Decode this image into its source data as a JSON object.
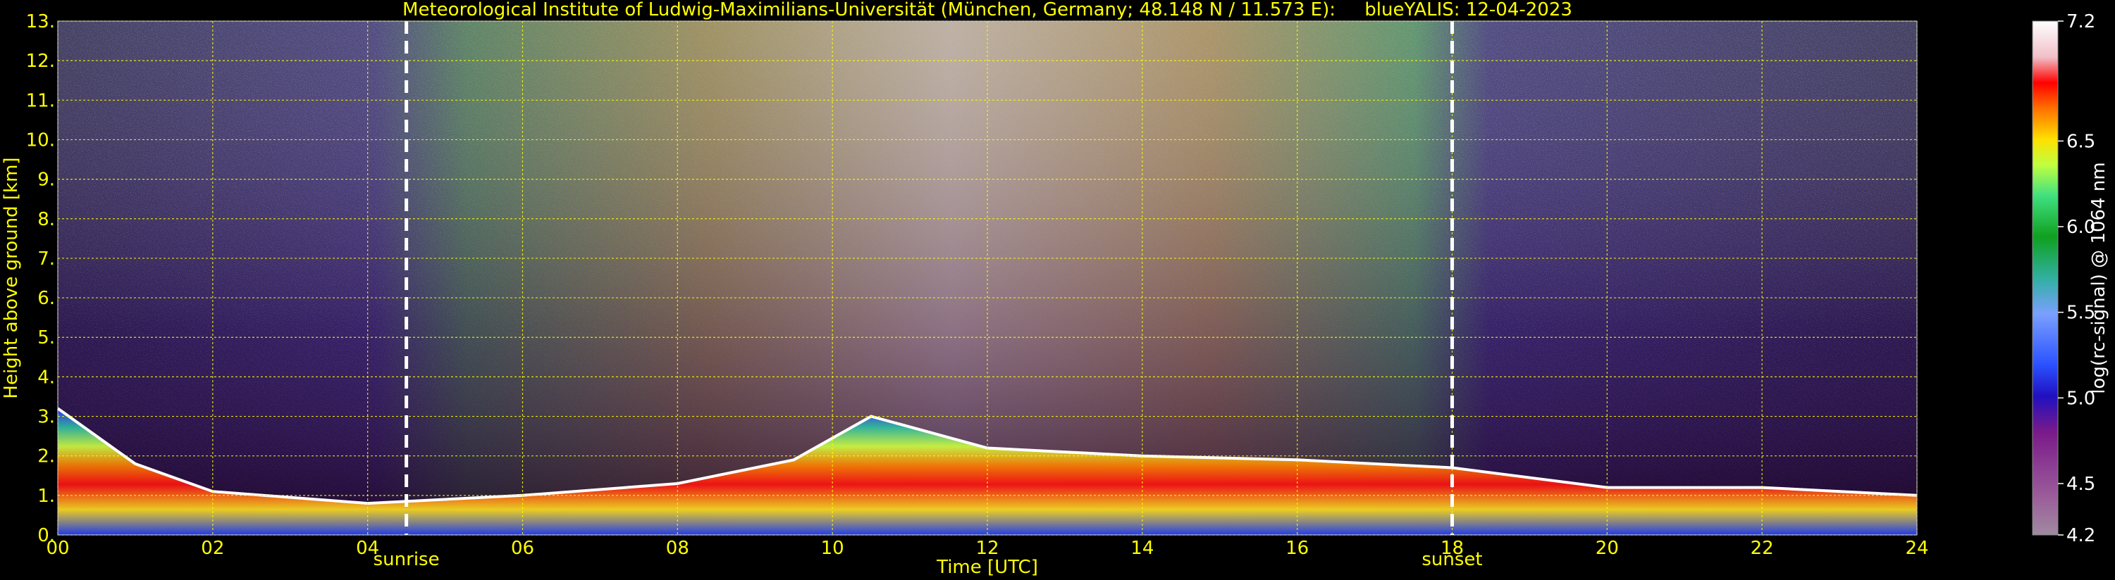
{
  "chart_data": {
    "type": "heatmap",
    "title": "Meteorological Institute of Ludwig-Maximilians-Universität (München, Germany; 48.148 N / 11.573 E):     blueYALIS: 12-04-2023",
    "xlabel": "Time [UTC]",
    "ylabel": "Height above ground [km]",
    "xlim": [
      0,
      24
    ],
    "ylim": [
      0,
      13
    ],
    "x_ticks": [
      "00",
      "02",
      "04",
      "06",
      "08",
      "10",
      "12",
      "14",
      "16",
      "18",
      "20",
      "22",
      "24"
    ],
    "y_ticks": [
      "0.",
      "1.",
      "2.",
      "3.",
      "4.",
      "5.",
      "6.",
      "7.",
      "8.",
      "9.",
      "10.",
      "11.",
      "12.",
      "13."
    ],
    "grid": true,
    "grid_color": "#ffff00",
    "annotations": [
      {
        "label": "sunrise",
        "x": 4.5
      },
      {
        "label": "sunset",
        "x": 18.0
      }
    ],
    "colorbar": {
      "label": "log(rc-signal) @ 1064 nm",
      "range": [
        4.2,
        7.2
      ],
      "ticks": [
        "4.2",
        "4.5",
        "5.0",
        "5.5",
        "6.0",
        "6.5",
        "7.2"
      ]
    },
    "boundary_layer_top_km": [
      {
        "x": 0.0,
        "y": 3.2
      },
      {
        "x": 1.0,
        "y": 1.8
      },
      {
        "x": 2.0,
        "y": 1.1
      },
      {
        "x": 4.0,
        "y": 0.8
      },
      {
        "x": 6.0,
        "y": 1.0
      },
      {
        "x": 8.0,
        "y": 1.3
      },
      {
        "x": 9.5,
        "y": 1.9
      },
      {
        "x": 10.5,
        "y": 3.0
      },
      {
        "x": 12.0,
        "y": 2.2
      },
      {
        "x": 14.0,
        "y": 2.0
      },
      {
        "x": 16.0,
        "y": 1.9
      },
      {
        "x": 18.0,
        "y": 1.7
      },
      {
        "x": 20.0,
        "y": 1.2
      },
      {
        "x": 22.0,
        "y": 1.2
      },
      {
        "x": 24.0,
        "y": 1.0
      }
    ]
  },
  "colors": {
    "axis_text": "#ffff00",
    "colorbar_text": "#ffffff",
    "background": "#000000"
  }
}
